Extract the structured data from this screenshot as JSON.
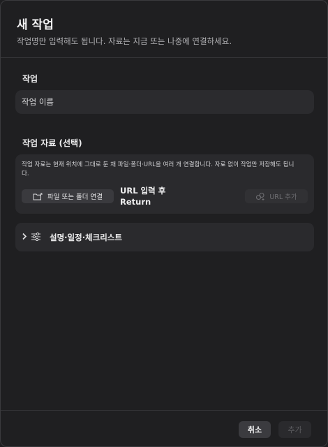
{
  "dialog": {
    "title": "새 작업",
    "subtitle": "작업명만 입력해도 됩니다. 자료는 지금 또는 나중에 연결하세요."
  },
  "task_section": {
    "label": "작업",
    "name_placeholder": "작업 이름"
  },
  "resources_section": {
    "label": "작업 자료 (선택)",
    "description": "작업 자료는 현재 위치에 그대로 둔 채 파일·폴더·URL을 여러 개 연결합니다. 자료 없이 작업만 저장해도 됩니다.",
    "link_button": "파일 또는 폴더 연결",
    "url_hint_line1": "URL 입력 후",
    "url_hint_line2": "Return",
    "url_add_button": "URL 추가"
  },
  "details": {
    "label": "설명·일정·체크리스트",
    "expanded": false
  },
  "footer": {
    "cancel_label": "취소",
    "add_label": "추가"
  },
  "icons": {
    "folder": "folder-link-icon",
    "link": "link-icon",
    "chevron": "chevron-right-icon",
    "sliders": "sliders-icon"
  },
  "colors": {
    "background": "#1f1f21",
    "card": "#2a2a2d",
    "disabled_text": "#6e6e72"
  }
}
